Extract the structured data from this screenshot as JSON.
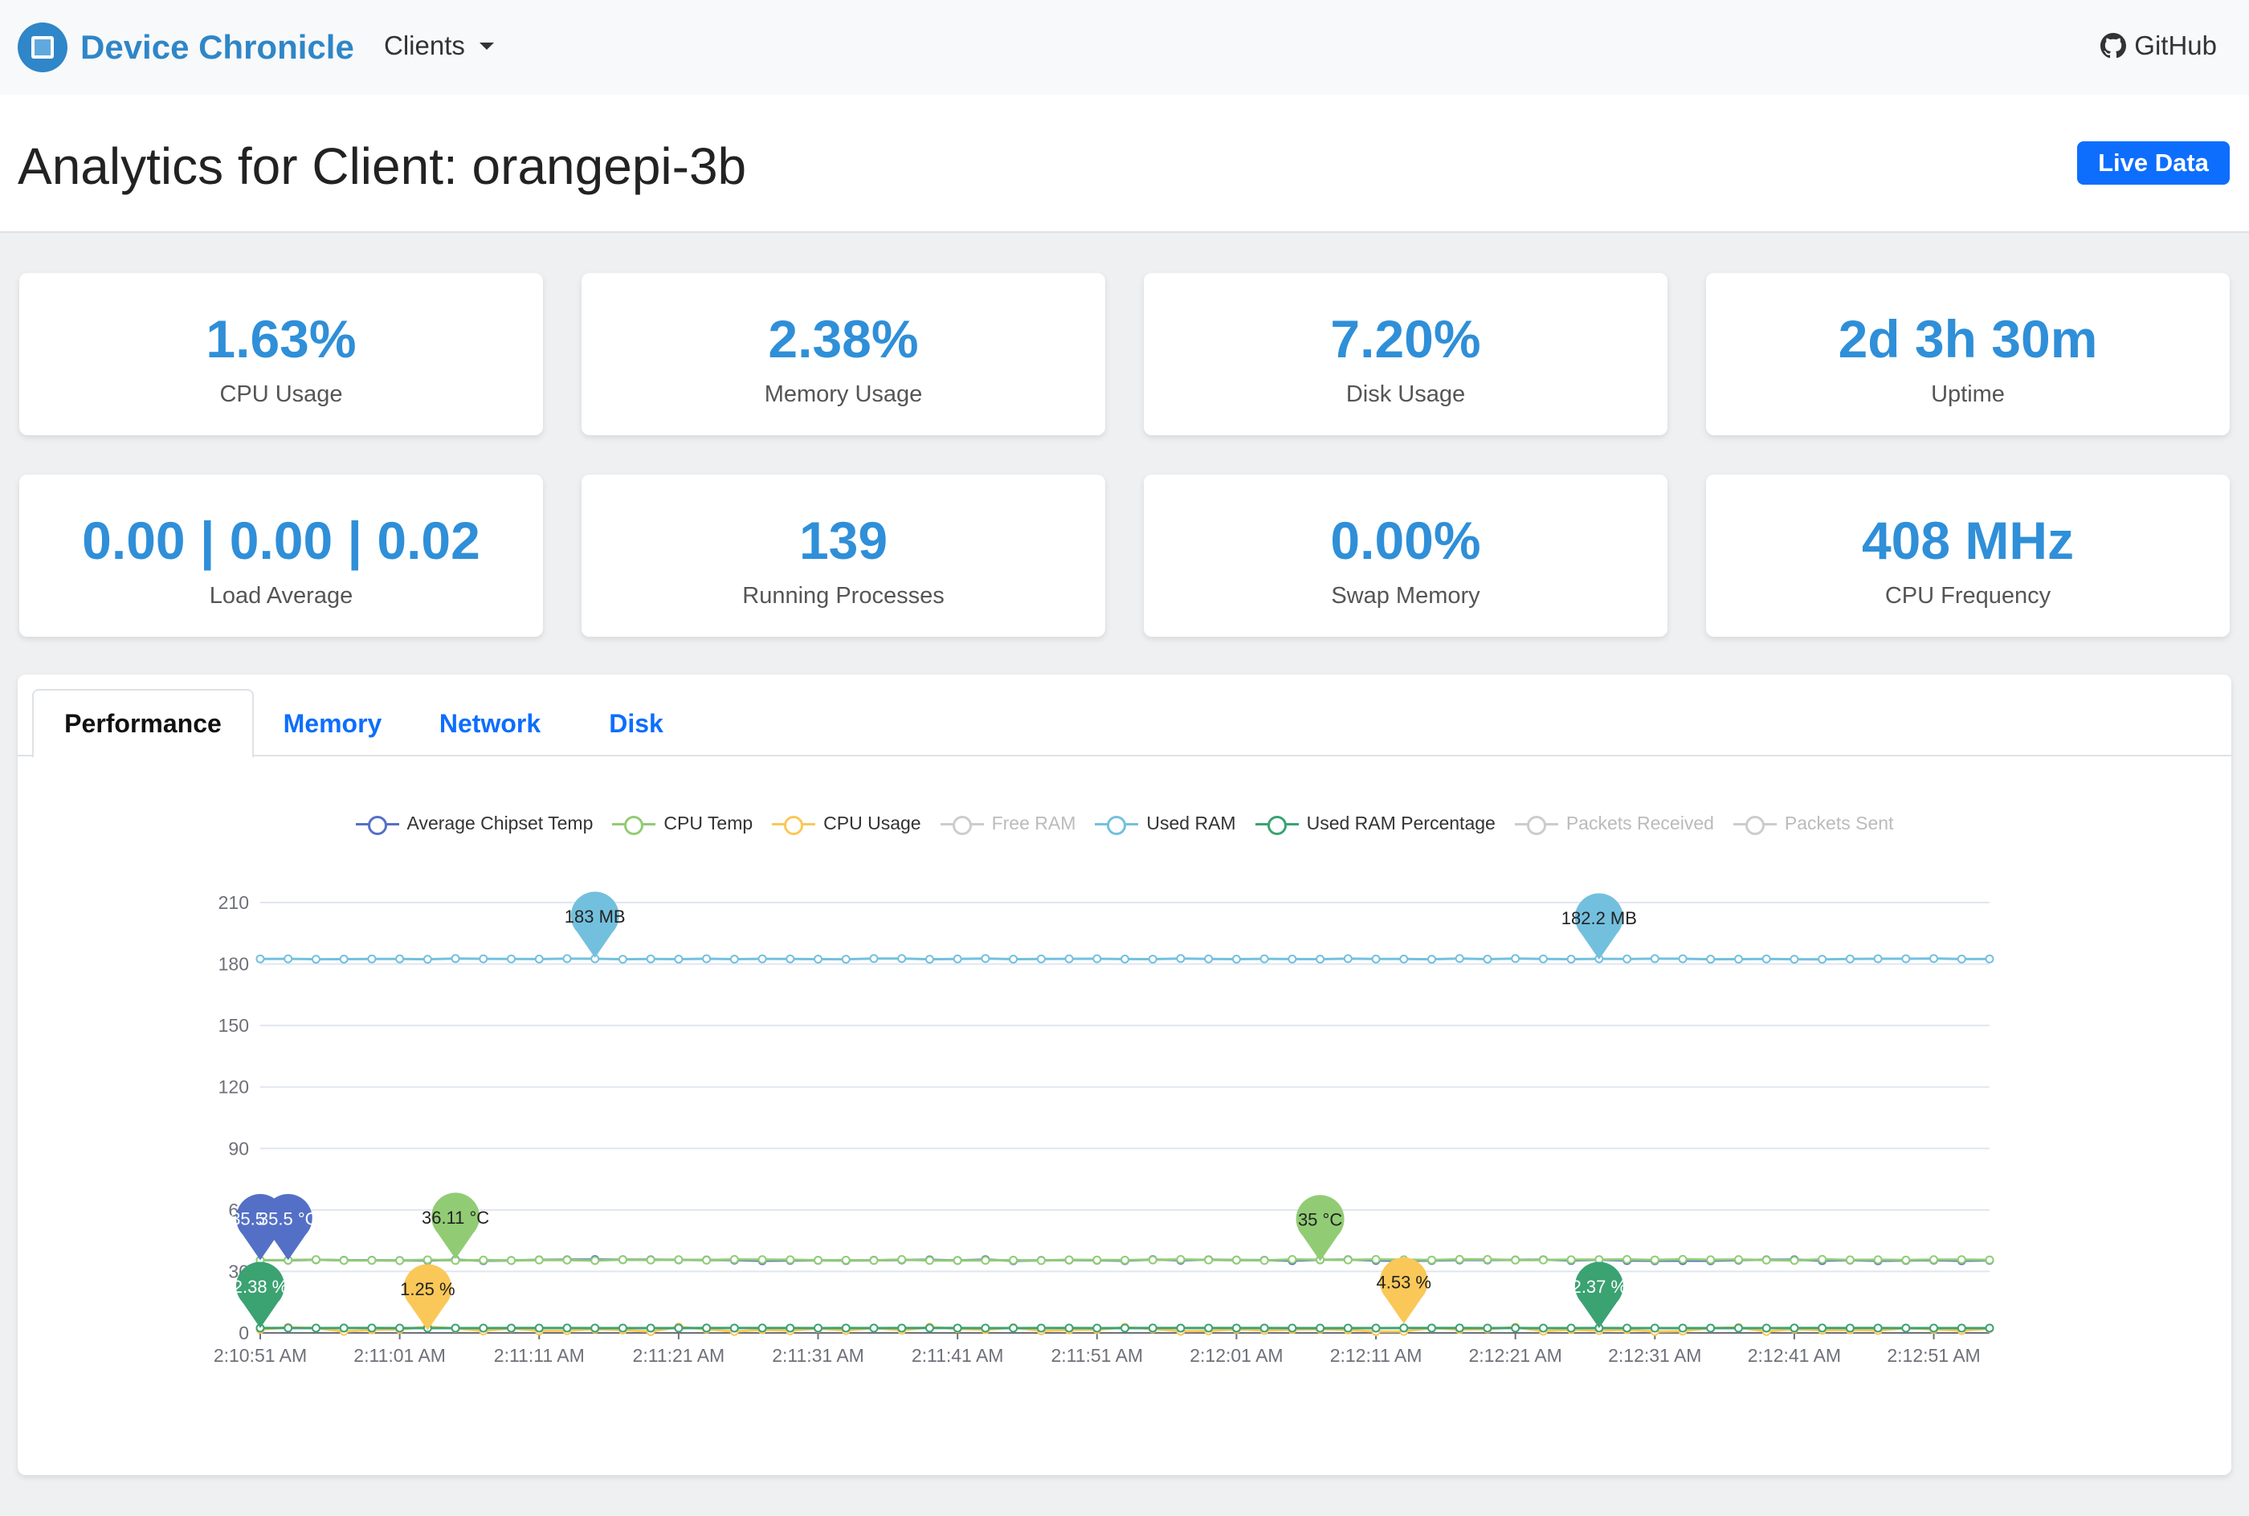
{
  "nav": {
    "brand": "Device Chronicle",
    "clients_label": "Clients",
    "github_label": "GitHub"
  },
  "header": {
    "title": "Analytics for Client: orangepi-3b",
    "live_button": "Live Data"
  },
  "stats": [
    {
      "value": "1.63%",
      "label": "CPU Usage"
    },
    {
      "value": "2.38%",
      "label": "Memory Usage"
    },
    {
      "value": "7.20%",
      "label": "Disk Usage"
    },
    {
      "value": "2d 3h 30m",
      "label": "Uptime"
    },
    {
      "value": "0.00 | 0.00 | 0.02",
      "label": "Load Average"
    },
    {
      "value": "139",
      "label": "Running Processes"
    },
    {
      "value": "0.00%",
      "label": "Swap Memory"
    },
    {
      "value": "408 MHz",
      "label": "CPU Frequency"
    }
  ],
  "tabs": [
    {
      "label": "Performance",
      "active": true
    },
    {
      "label": "Memory",
      "active": false
    },
    {
      "label": "Network",
      "active": false
    },
    {
      "label": "Disk",
      "active": false
    }
  ],
  "colors": {
    "brand": "#2f86c8",
    "stat_value": "#2f8fd8",
    "primary": "#0d6efd"
  },
  "chart_data": {
    "type": "line",
    "ylim": [
      0,
      210
    ],
    "yticks": [
      0,
      30,
      60,
      90,
      120,
      150,
      180,
      210
    ],
    "xtick_labels": [
      "2:10:51 AM",
      "2:11:01 AM",
      "2:11:11 AM",
      "2:11:21 AM",
      "2:11:31 AM",
      "2:11:41 AM",
      "2:11:51 AM",
      "2:12:01 AM",
      "2:12:11 AM",
      "2:12:21 AM",
      "2:12:31 AM",
      "2:12:41 AM",
      "2:12:51 AM"
    ],
    "points": 63,
    "legend": [
      {
        "name": "Average Chipset Temp",
        "color": "#5470c6",
        "visible": true
      },
      {
        "name": "CPU Temp",
        "color": "#91cc75",
        "visible": true
      },
      {
        "name": "CPU Usage",
        "color": "#fac858",
        "visible": true
      },
      {
        "name": "Free RAM",
        "color": "#cccccc",
        "visible": false
      },
      {
        "name": "Used RAM",
        "color": "#73c0de",
        "visible": true
      },
      {
        "name": "Used RAM Percentage",
        "color": "#3ba272",
        "visible": true
      },
      {
        "name": "Packets Received",
        "color": "#cccccc",
        "visible": false
      },
      {
        "name": "Packets Sent",
        "color": "#cccccc",
        "visible": false
      }
    ],
    "series": [
      {
        "name": "Used RAM",
        "color": "#73c0de",
        "base": 182.5,
        "jitter": 0.2
      },
      {
        "name": "Average Chipset Temp",
        "color": "#5470c6",
        "base": 35.5,
        "jitter": 0.3
      },
      {
        "name": "CPU Temp",
        "color": "#91cc75",
        "base": 35.6,
        "jitter": 0.3
      },
      {
        "name": "CPU Usage",
        "color": "#fac858",
        "base": 1.8,
        "jitter": 1.2
      },
      {
        "name": "Used RAM Percentage",
        "color": "#3ba272",
        "base": 2.37,
        "jitter": 0.01
      }
    ],
    "markers": [
      {
        "label": "183 MB",
        "color": "#73c0de",
        "index": 12,
        "value": 183,
        "text_color": "#222"
      },
      {
        "label": "182.2 MB",
        "color": "#73c0de",
        "index": 48,
        "value": 182.2,
        "text_color": "#222"
      },
      {
        "label": "35.5 °C",
        "color": "#5470c6",
        "index": 0,
        "value": 35.5,
        "text_color": "#fff"
      },
      {
        "label": "35.5 °C",
        "color": "#5470c6",
        "index": 1,
        "value": 35.5,
        "text_color": "#fff"
      },
      {
        "label": "36.11 °C",
        "color": "#91cc75",
        "index": 7,
        "value": 36.11,
        "text_color": "#222"
      },
      {
        "label": "35 °C",
        "color": "#91cc75",
        "index": 38,
        "value": 35,
        "text_color": "#222"
      },
      {
        "label": "1.25 %",
        "color": "#fac858",
        "index": 6,
        "value": 1.25,
        "text_color": "#222"
      },
      {
        "label": "4.53 %",
        "color": "#fac858",
        "index": 41,
        "value": 4.53,
        "text_color": "#222"
      },
      {
        "label": "2.38 %",
        "color": "#3ba272",
        "index": 0,
        "value": 2.38,
        "text_color": "#fff"
      },
      {
        "label": "2.37 %",
        "color": "#3ba272",
        "index": 48,
        "value": 2.37,
        "text_color": "#fff"
      }
    ]
  }
}
